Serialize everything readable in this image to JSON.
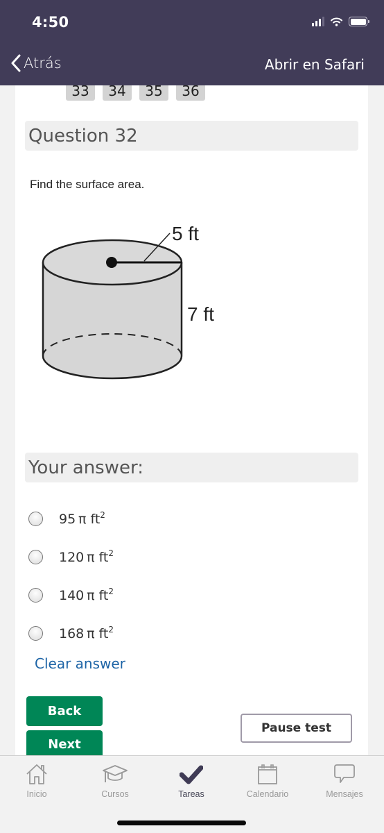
{
  "status_bar": {
    "time": "4:50",
    "icons": [
      "cellular-signal-icon",
      "wifi-icon",
      "battery-icon"
    ]
  },
  "nav_bar": {
    "back_label": "Atrás",
    "back_icon": "chevron-left-icon",
    "open_in_safari_label": "Abrir en Safari"
  },
  "pager": {
    "pages": [
      "33",
      "34",
      "35",
      "36"
    ]
  },
  "question": {
    "title": "Question 32",
    "prompt": "Find the surface area.",
    "figure": {
      "shape": "cylinder",
      "radius_label": "5 ft",
      "height_label": "7 ft"
    }
  },
  "answer": {
    "heading": "Your answer:",
    "options": [
      {
        "value": "95",
        "pi": "π",
        "unit": "ft",
        "exp": "2",
        "selected": false
      },
      {
        "value": "120",
        "pi": "π",
        "unit": "ft",
        "exp": "2",
        "selected": false
      },
      {
        "value": "140",
        "pi": "π",
        "unit": "ft",
        "exp": "2",
        "selected": false
      },
      {
        "value": "168",
        "pi": "π",
        "unit": "ft",
        "exp": "2",
        "selected": false
      }
    ],
    "clear_label": "Clear answer"
  },
  "actions": {
    "back_label": "Back",
    "next_label": "Next",
    "pause_label": "Pause test",
    "accent_color": "#008656"
  },
  "tab_bar": {
    "tabs": [
      {
        "label": "Inicio",
        "icon": "home-icon",
        "active": false
      },
      {
        "label": "Cursos",
        "icon": "graduation-cap-icon",
        "active": false
      },
      {
        "label": "Tareas",
        "icon": "checkmark-icon",
        "active": true
      },
      {
        "label": "Calendario",
        "icon": "calendar-icon",
        "active": false
      },
      {
        "label": "Mensajes",
        "icon": "message-bubble-icon",
        "active": false
      }
    ]
  }
}
